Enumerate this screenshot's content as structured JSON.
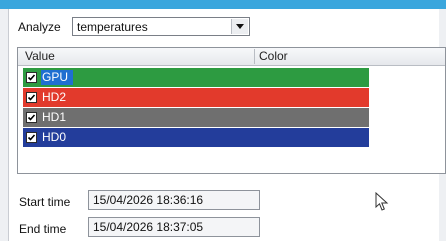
{
  "analyze": {
    "label": "Analyze",
    "selected": "temperatures"
  },
  "list": {
    "headers": {
      "value": "Value",
      "color": "Color"
    },
    "rows": [
      {
        "label": "GPU",
        "checked": true,
        "color": "#2d9b41",
        "label_highlight": "#1f6fd1"
      },
      {
        "label": "HD2",
        "checked": true,
        "color": "#e23a2c"
      },
      {
        "label": "HD1",
        "checked": true,
        "color": "#6f6f6f"
      },
      {
        "label": "HD0",
        "checked": true,
        "color": "#233d9b"
      }
    ]
  },
  "times": {
    "start_label": "Start time",
    "start_value": "15/04/2026 18:36:16",
    "end_label": "End time",
    "end_value": "15/04/2026 18:37:05"
  },
  "icons": {
    "dropdown": "chevron-down-icon",
    "checkbox": "checkmark-icon",
    "cursor": "mouse-pointer-icon"
  }
}
